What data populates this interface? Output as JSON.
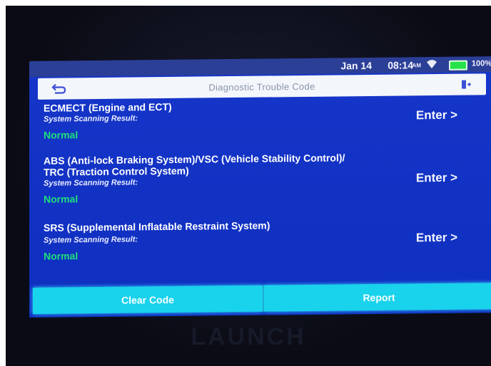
{
  "status_bar": {
    "date": "Jan 14",
    "time": "08:14",
    "ampm": "AM",
    "battery": "100%"
  },
  "title_bar": {
    "title": "Diagnostic Trouble Code",
    "back_icon": "back-arrow-icon",
    "exit_icon": "exit-icon"
  },
  "systems": [
    {
      "name_line1": "ECMECT (Engine and ECT)",
      "name_line2": "",
      "subtitle": "System Scanning Result:",
      "status": "Normal",
      "action": "Enter >"
    },
    {
      "name_line1": "ABS (Anti-lock Braking System)/VSC (Vehicle Stability Control)/",
      "name_line2": "TRC (Traction Control System)",
      "subtitle": "System Scanning Result:",
      "status": "Normal",
      "action": "Enter >"
    },
    {
      "name_line1": "SRS (Supplemental Inflatable Restraint System)",
      "name_line2": "",
      "subtitle": "System Scanning Result:",
      "status": "Normal",
      "action": "Enter >"
    }
  ],
  "buttons": {
    "clear_code": "Clear Code",
    "report": "Report"
  },
  "brand": "LAUNCH",
  "colors": {
    "screen": "#1636c9",
    "status_ok": "#1ee07a",
    "button": "#19d2ec"
  }
}
